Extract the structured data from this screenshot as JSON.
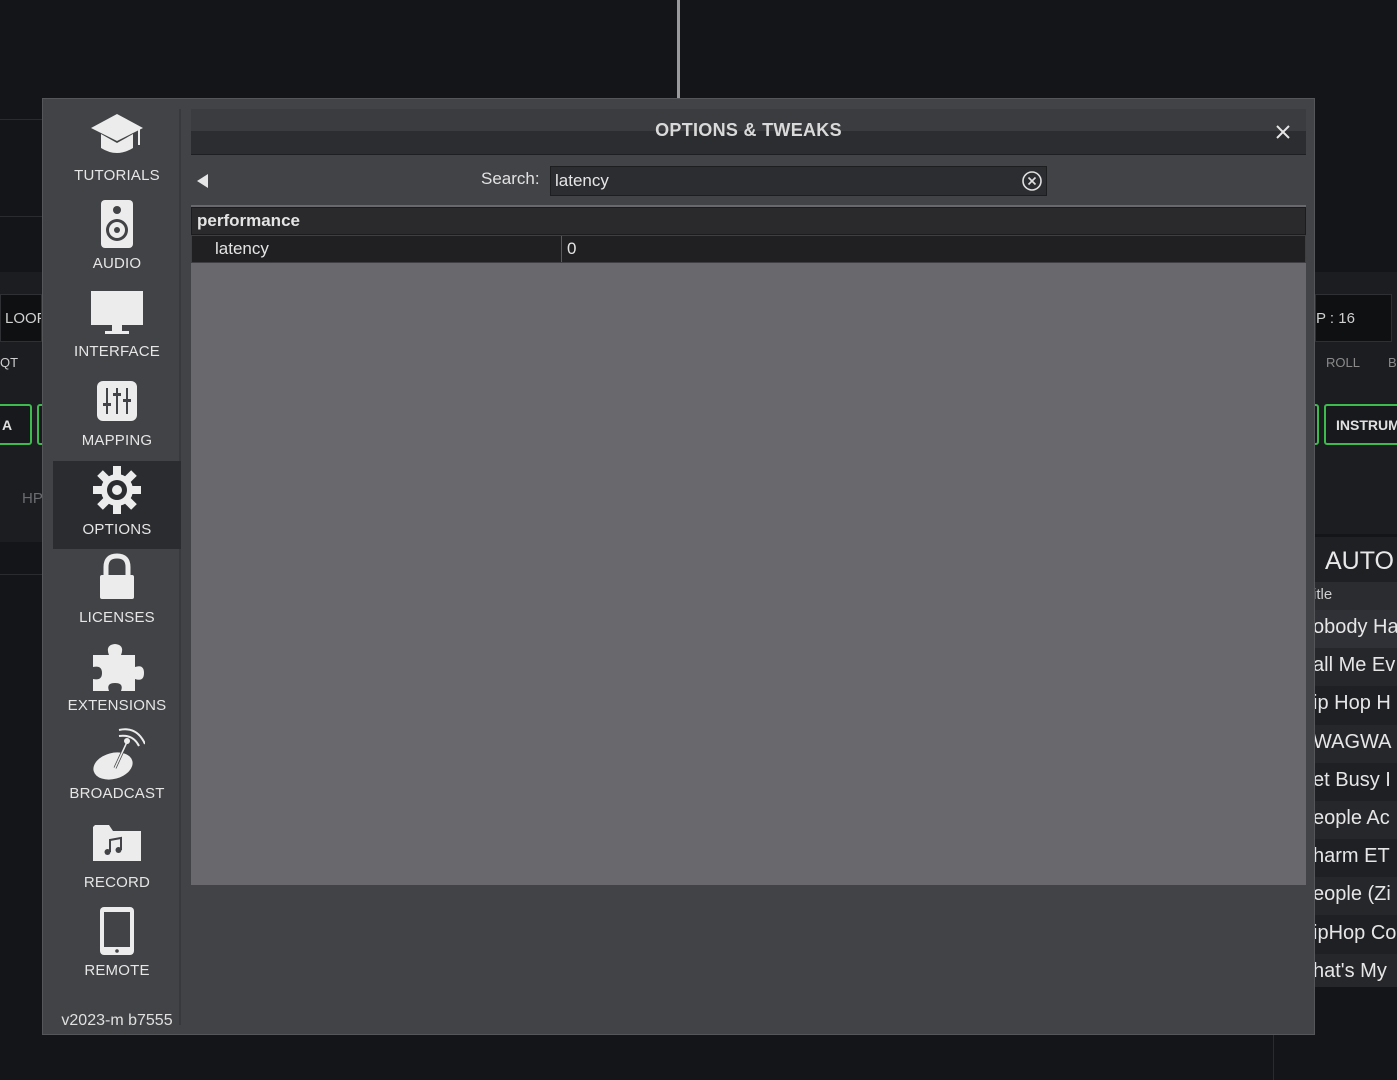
{
  "background": {
    "left_labels": {
      "loop": "LOOP",
      "qt": "QT",
      "pad": "A",
      "hp": "HP"
    },
    "right_labels": {
      "loop": "P : 16",
      "roll": "ROLL",
      "b": "B",
      "pad": "INSTRUM"
    },
    "browser": {
      "title": "AUTO",
      "column_header": "itle",
      "rows": [
        "obody Ha",
        "all Me Ev",
        "ip Hop H",
        "WAGWA",
        "et Busy I",
        "eople Ac",
        "harm ET",
        "eople (Zi",
        "ipHop Co",
        "hat's My"
      ]
    }
  },
  "sidebar": {
    "items": [
      {
        "label": "TUTORIALS",
        "icon": "graduation-cap-icon"
      },
      {
        "label": "AUDIO",
        "icon": "speaker-icon"
      },
      {
        "label": "INTERFACE",
        "icon": "monitor-icon"
      },
      {
        "label": "MAPPING",
        "icon": "sliders-icon"
      },
      {
        "label": "OPTIONS",
        "icon": "gear-icon",
        "active": true
      },
      {
        "label": "LICENSES",
        "icon": "lock-icon"
      },
      {
        "label": "EXTENSIONS",
        "icon": "puzzle-icon"
      },
      {
        "label": "BROADCAST",
        "icon": "satellite-dish-icon"
      },
      {
        "label": "RECORD",
        "icon": "music-folder-icon"
      },
      {
        "label": "REMOTE",
        "icon": "tablet-icon"
      }
    ],
    "version": "v2023-m b7555"
  },
  "dialog": {
    "title": "OPTIONS & TWEAKS",
    "close_icon": "close-icon",
    "back_icon": "back-arrow-icon"
  },
  "search": {
    "label": "Search:",
    "value": "latency",
    "clear_icon": "clear-search-icon"
  },
  "results": {
    "group": "performance",
    "settings": [
      {
        "name": "latency",
        "value": "0"
      }
    ]
  },
  "colors": {
    "accent_green": "#3dbb4f",
    "panel": "#424346",
    "table_bg": "#69686d"
  }
}
